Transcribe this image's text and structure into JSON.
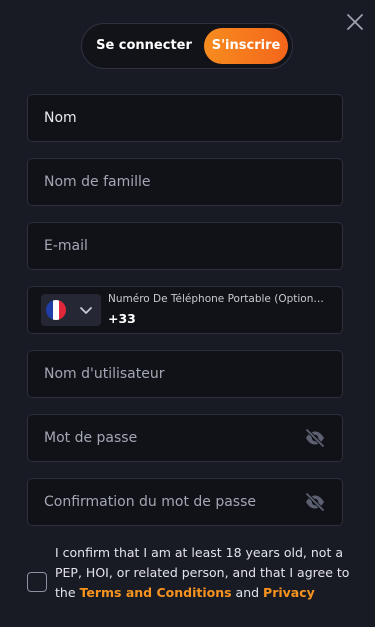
{
  "tabs": {
    "login_label": "Se connecter",
    "register_label": "S'inscrire"
  },
  "form": {
    "first_name_placeholder": "Nom",
    "last_name_placeholder": "Nom de famille",
    "email_placeholder": "E-mail",
    "phone": {
      "label": "Numéro De Téléphone Portable (Option…",
      "country_code": "+33",
      "country_flag": "france-flag-icon"
    },
    "username_placeholder": "Nom d'utilisateur",
    "password_placeholder": "Mot de passe",
    "password_confirm_placeholder": "Confirmation du mot de passe"
  },
  "consent": {
    "text": "I confirm that I am at least 18 years old, not a PEP, HOI, or related person, and that I agree to the",
    "terms_link": "Terms and Conditions",
    "and": "and",
    "privacy_link": "Privacy",
    "checked": false
  },
  "colors": {
    "background": "#181a24",
    "accent": "#f7931e",
    "accent_gradient_end": "#f4661b",
    "field_bg": "#111218",
    "field_border": "#2c2f3c"
  },
  "icons": {
    "close": "close-icon",
    "eye": "eye-off-icon",
    "chevron": "chevron-down-icon"
  }
}
